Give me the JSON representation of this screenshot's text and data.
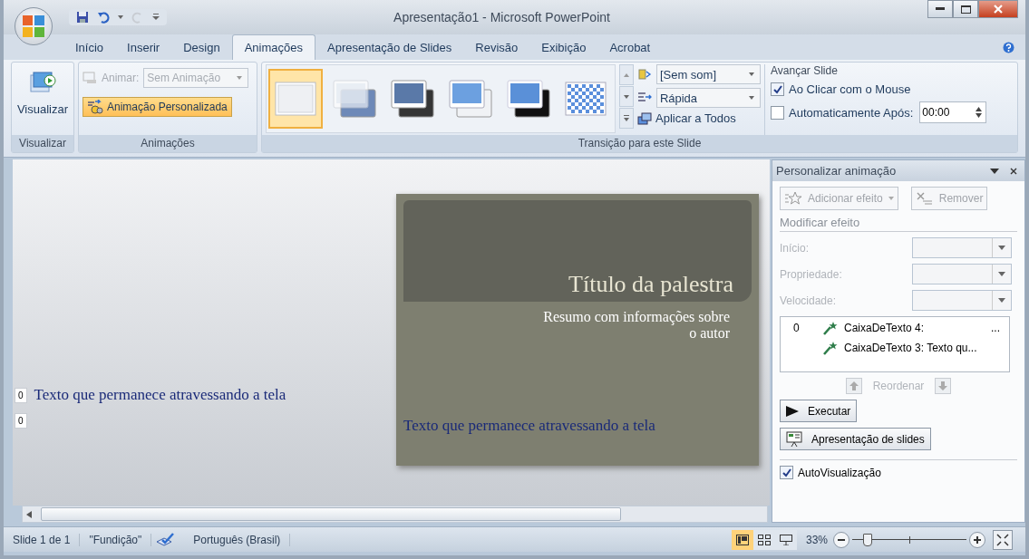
{
  "window": {
    "title": "Apresentação1 - Microsoft PowerPoint"
  },
  "tabs": [
    {
      "label": "Início",
      "selected": false
    },
    {
      "label": "Inserir",
      "selected": false
    },
    {
      "label": "Design",
      "selected": false
    },
    {
      "label": "Animações",
      "selected": true
    },
    {
      "label": "Apresentação de Slides",
      "selected": false
    },
    {
      "label": "Revisão",
      "selected": false
    },
    {
      "label": "Exibição",
      "selected": false
    },
    {
      "label": "Acrobat",
      "selected": false
    }
  ],
  "ribbon": {
    "preview_group": {
      "button": "Visualizar",
      "label": "Visualizar"
    },
    "animations_group": {
      "animate_label": "Animar:",
      "animate_value": "Sem Animação",
      "disabled": true,
      "custom_button": "Animação Personalizada",
      "custom_selected": true,
      "label": "Animações"
    },
    "transition_group": {
      "label": "Transição para este Slide",
      "thumbnails": [
        {
          "kind": "none",
          "selected": true
        },
        {
          "kind": "fade",
          "selected": false
        },
        {
          "kind": "dark",
          "selected": false
        },
        {
          "kind": "push",
          "selected": false
        },
        {
          "kind": "black",
          "selected": false
        },
        {
          "kind": "checker",
          "selected": false
        }
      ],
      "sound": "[Sem som]",
      "speed": "Rápida",
      "apply_all": "Aplicar a Todos",
      "advance_title": "Avançar Slide",
      "advance_options": [
        {
          "label": "Ao Clicar com o Mouse",
          "checked": true
        },
        {
          "label": "Automaticamente Após:",
          "checked": false
        }
      ],
      "time": "00:00"
    }
  },
  "canvas": {
    "markers": [
      {
        "number": "0",
        "text": "Texto que permanece atravessando a tela"
      },
      {
        "number": "0"
      }
    ],
    "slide": {
      "title": "Título da palestra",
      "subtitle": "Resumo com informações sobre\no autor",
      "body": "Texto que permanece atravessando a tela"
    }
  },
  "task_pane": {
    "title": "Personalizar animação",
    "add_effect": "Adicionar efeito",
    "remove": "Remover",
    "section": "Modificar efeito",
    "fields": [
      {
        "label": "Início:"
      },
      {
        "label": "Propriedade:"
      },
      {
        "label": "Velocidade:"
      }
    ],
    "effects": [
      {
        "number": "0",
        "name": "CaixaDeTexto 4:",
        "more": "..."
      },
      {
        "name": "CaixaDeTexto 3: Texto qu..."
      }
    ],
    "reorder": "Reordenar",
    "play": "Executar",
    "slideshow": "Apresentação de slides",
    "autopreview": {
      "label": "AutoVisualização",
      "checked": true
    }
  },
  "status_bar": {
    "slide": "Slide 1 de 1",
    "theme": "\"Fundição\"",
    "language": "Português (Brasil)",
    "views": [
      {
        "kind": "normal",
        "selected": true
      },
      {
        "kind": "sorter",
        "selected": false
      },
      {
        "kind": "show",
        "selected": false
      }
    ],
    "zoom": "33%",
    "level": 0.13
  }
}
